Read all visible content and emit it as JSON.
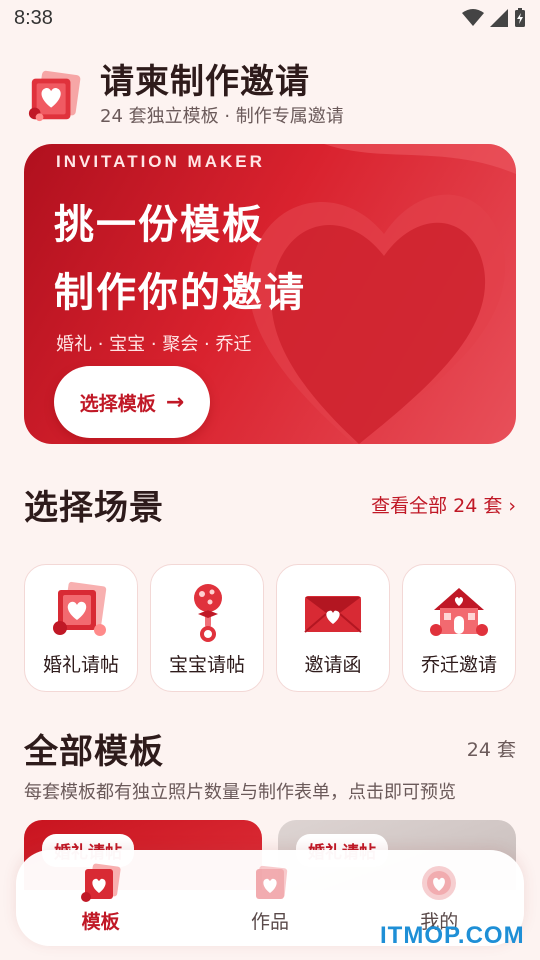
{
  "status_bar": {
    "time": "8:38"
  },
  "app_header": {
    "title": "请柬制作邀请",
    "subtitle": "24 套独立模板 · 制作专属邀请"
  },
  "hero": {
    "tag": "INVITATION MAKER",
    "line1": "挑一份模板",
    "line2": "制作你的邀请",
    "tags": "婚礼 · 宝宝 · 聚会 · 乔迁",
    "button_label": "选择模板",
    "button_arrow": "→"
  },
  "scenes_section": {
    "title": "选择场景",
    "view_all": "查看全部 24 套 ›",
    "items": [
      {
        "label": "婚礼请帖",
        "icon": "wedding-card-icon"
      },
      {
        "label": "宝宝请帖",
        "icon": "baby-rattle-icon"
      },
      {
        "label": "邀请函",
        "icon": "envelope-icon"
      },
      {
        "label": "乔迁邀请",
        "icon": "house-icon"
      }
    ]
  },
  "templates_section": {
    "title": "全部模板",
    "count": "24 套",
    "description": "每套模板都有独立照片数量与制作表单，点击即可预览",
    "cards": [
      {
        "badge": "婚礼请帖"
      },
      {
        "badge": "婚礼请帖"
      }
    ]
  },
  "tabbar": {
    "items": [
      {
        "label": "模板",
        "icon": "template-icon",
        "active": true
      },
      {
        "label": "作品",
        "icon": "works-icon",
        "active": false
      },
      {
        "label": "我的",
        "icon": "profile-icon",
        "active": false
      }
    ]
  },
  "watermark": "ITMOP.COM",
  "colors": {
    "accent": "#c01826",
    "background": "#fdf3f1"
  }
}
